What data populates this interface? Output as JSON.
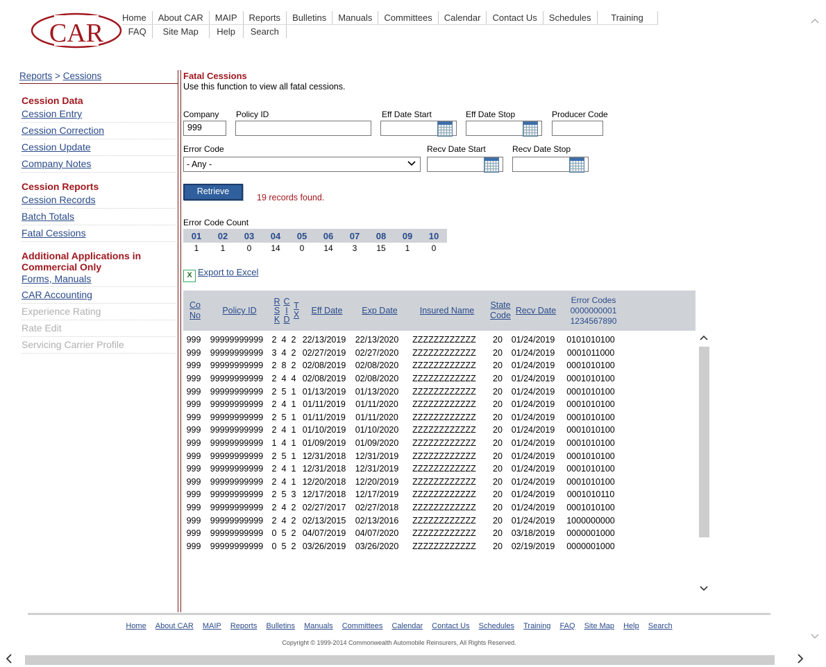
{
  "logo": {
    "text": "CAR"
  },
  "topnav": {
    "row1": [
      "Home",
      "About CAR",
      "MAIP",
      "Reports",
      "Bulletins",
      "Manuals",
      "Committees",
      "Calendar",
      "Contact Us",
      "Schedules",
      "Training"
    ],
    "row2": [
      "FAQ",
      "Site Map",
      "Help",
      "Search"
    ]
  },
  "breadcrumb": {
    "part1": "Reports",
    "sep": ">",
    "part2": "Cessions"
  },
  "leftnav": {
    "sections": [
      {
        "title": "Cession Data",
        "items": [
          {
            "label": "Cession Entry",
            "disabled": false
          },
          {
            "label": "Cession Correction",
            "disabled": false
          },
          {
            "label": "Cession Update",
            "disabled": false
          },
          {
            "label": "Company Notes",
            "disabled": false
          }
        ]
      },
      {
        "title": "Cession Reports",
        "items": [
          {
            "label": "Cession Records",
            "disabled": false
          },
          {
            "label": "Batch Totals",
            "disabled": false
          },
          {
            "label": "Fatal Cessions",
            "disabled": false
          }
        ]
      },
      {
        "title": "Additional Applications in Commercial Only",
        "items": [
          {
            "label": "Forms, Manuals",
            "disabled": false
          },
          {
            "label": "CAR Accounting",
            "disabled": false
          },
          {
            "label": "Experience Rating",
            "disabled": true
          },
          {
            "label": "Rate Edit",
            "disabled": true
          },
          {
            "label": "Servicing Carrier Profile",
            "disabled": true
          }
        ]
      }
    ]
  },
  "main": {
    "title": "Fatal Cessions",
    "subtitle": "Use this function to view all fatal cessions.",
    "form": {
      "company_label": "Company",
      "company_value": "999",
      "policy_label": "Policy ID",
      "policy_value": "",
      "eff_start_label": "Eff Date Start",
      "eff_stop_label": "Eff Date Stop",
      "producer_label": "Producer Code",
      "error_code_label": "Error Code",
      "error_code_value": "- Any -",
      "recv_start_label": "Recv Date Start",
      "recv_stop_label": "Recv Date Stop"
    },
    "retrieve_label": "Retrieve",
    "records_found": "19 records found.",
    "error_code_count": {
      "label": "Error Code Count",
      "codes": [
        "01",
        "02",
        "03",
        "04",
        "05",
        "06",
        "07",
        "08",
        "09",
        "10"
      ],
      "counts": [
        "1",
        "1",
        "0",
        "14",
        "0",
        "14",
        "3",
        "15",
        "1",
        "0"
      ]
    },
    "export_label": "Export to Excel",
    "table": {
      "headers": {
        "co_no": "Co No",
        "policy_id": "Policy ID",
        "rsk": "RSK",
        "cid": "CID",
        "tx": "TX",
        "eff_date": "Eff Date",
        "exp_date": "Exp Date",
        "insured_name": "Insured Name",
        "state_code": "State Code",
        "recv_date": "Recv Date",
        "error_codes_title": "Error Codes",
        "error_codes_l1": "0000000001",
        "error_codes_l2": "1234567890"
      },
      "rows": [
        [
          "999",
          "99999999999",
          "2",
          "4",
          "2",
          "22/13/2019",
          "22/13/2020",
          "ZZZZZZZZZZZZ",
          "20",
          "01/24/2019",
          "0101010100"
        ],
        [
          "999",
          "99999999999",
          "3",
          "4",
          "2",
          "02/27/2019",
          "02/27/2020",
          "ZZZZZZZZZZZZ",
          "20",
          "01/24/2019",
          "0001011000"
        ],
        [
          "999",
          "99999999999",
          "2",
          "8",
          "2",
          "02/08/2019",
          "02/08/2020",
          "ZZZZZZZZZZZZ",
          "20",
          "01/24/2019",
          "0001010100"
        ],
        [
          "999",
          "99999999999",
          "2",
          "4",
          "4",
          "02/08/2019",
          "02/08/2020",
          "ZZZZZZZZZZZZ",
          "20",
          "01/24/2019",
          "0001010100"
        ],
        [
          "999",
          "99999999999",
          "2",
          "5",
          "1",
          "01/13/2019",
          "01/13/2020",
          "ZZZZZZZZZZZZ",
          "20",
          "01/24/2019",
          "0001010100"
        ],
        [
          "999",
          "99999999999",
          "2",
          "4",
          "1",
          "01/11/2019",
          "01/11/2020",
          "ZZZZZZZZZZZZ",
          "20",
          "01/24/2019",
          "0001010100"
        ],
        [
          "999",
          "99999999999",
          "2",
          "5",
          "1",
          "01/11/2019",
          "01/11/2020",
          "ZZZZZZZZZZZZ",
          "20",
          "01/24/2019",
          "0001010100"
        ],
        [
          "999",
          "99999999999",
          "2",
          "4",
          "1",
          "01/10/2019",
          "01/10/2020",
          "ZZZZZZZZZZZZ",
          "20",
          "01/24/2019",
          "0001010100"
        ],
        [
          "999",
          "99999999999",
          "1",
          "4",
          "1",
          "01/09/2019",
          "01/09/2020",
          "ZZZZZZZZZZZZ",
          "20",
          "01/24/2019",
          "0001010100"
        ],
        [
          "999",
          "99999999999",
          "2",
          "5",
          "1",
          "12/31/2018",
          "12/31/2019",
          "ZZZZZZZZZZZZ",
          "20",
          "01/24/2019",
          "0001010100"
        ],
        [
          "999",
          "99999999999",
          "2",
          "4",
          "1",
          "12/31/2018",
          "12/31/2019",
          "ZZZZZZZZZZZZ",
          "20",
          "01/24/2019",
          "0001010100"
        ],
        [
          "999",
          "99999999999",
          "2",
          "4",
          "1",
          "12/20/2018",
          "12/20/2019",
          "ZZZZZZZZZZZZ",
          "20",
          "01/24/2019",
          "0001010100"
        ],
        [
          "999",
          "99999999999",
          "2",
          "5",
          "3",
          "12/17/2018",
          "12/17/2019",
          "ZZZZZZZZZZZZ",
          "20",
          "01/24/2019",
          "0001010110"
        ],
        [
          "999",
          "99999999999",
          "2",
          "4",
          "2",
          "02/27/2017",
          "02/27/2018",
          "ZZZZZZZZZZZZ",
          "20",
          "01/24/2019",
          "0001010100"
        ],
        [
          "999",
          "99999999999",
          "2",
          "4",
          "2",
          "02/13/2015",
          "02/13/2016",
          "ZZZZZZZZZZZZ",
          "20",
          "01/24/2019",
          "1000000000"
        ],
        [
          "999",
          "99999999999",
          "0",
          "5",
          "2",
          "04/07/2019",
          "04/07/2020",
          "ZZZZZZZZZZZZ",
          "20",
          "03/18/2019",
          "0000001000"
        ],
        [
          "999",
          "99999999999",
          "0",
          "5",
          "2",
          "03/26/2019",
          "03/26/2020",
          "ZZZZZZZZZZZZ",
          "20",
          "02/19/2019",
          "0000001000"
        ]
      ]
    }
  },
  "footer": {
    "links": [
      "Home",
      "About CAR",
      "MAIP",
      "Reports",
      "Bulletins",
      "Manuals",
      "Committees",
      "Calendar",
      "Contact Us",
      "Schedules",
      "Training",
      "FAQ",
      "Site Map",
      "Help",
      "Search"
    ],
    "copyright": "Copyright © 1999-2014 Commonwealth Automobile Reinsurers, All Rights Reserved."
  },
  "colors": {
    "brand_red": "#a0181e",
    "link_blue": "#2a4a8a",
    "button_blue": "#2f5f9c",
    "header_gray": "#cfd3d8"
  },
  "icons": [
    "calendar-icon",
    "dropdown-chevron-icon",
    "excel-icon",
    "scroll-up-icon",
    "scroll-down-icon",
    "scroll-left-icon",
    "scroll-right-icon"
  ]
}
